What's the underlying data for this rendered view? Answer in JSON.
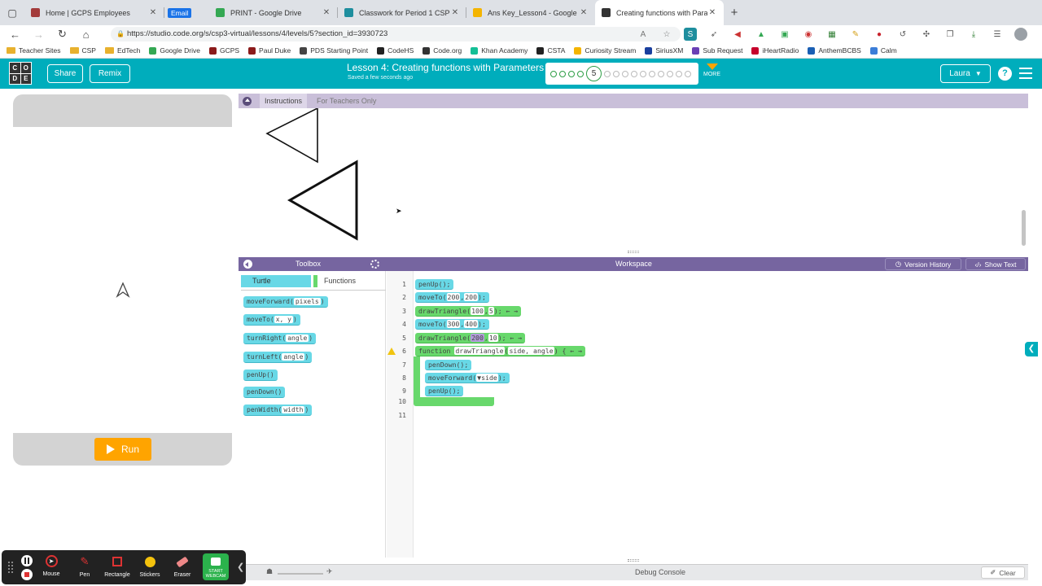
{
  "browser": {
    "tabs": [
      {
        "title": "Home | GCPS Employees",
        "color": "#a33b3b"
      },
      {
        "title": "PRINT - Google Drive",
        "color": "#34a853"
      },
      {
        "title": "Classwork for Period 1 CSP",
        "color": "#1e8e9e"
      },
      {
        "title": "Ans Key_Lesson4 - Google Sli",
        "color": "#f4b400"
      },
      {
        "title": "Creating functions with Param",
        "color": "#333333"
      }
    ],
    "email_badge": "Email",
    "url": "https://studio.code.org/s/csp3-virtual/lessons/4/levels/5?section_id=3930723",
    "bookmarks": [
      {
        "label": "Teacher Sites",
        "type": "folder"
      },
      {
        "label": "CSP",
        "type": "folder"
      },
      {
        "label": "EdTech",
        "type": "folder"
      },
      {
        "label": "Google Drive",
        "type": "site",
        "color": "#34a853"
      },
      {
        "label": "GCPS",
        "type": "site",
        "color": "#8b1a1a"
      },
      {
        "label": "Paul Duke",
        "type": "site",
        "color": "#8b1a1a"
      },
      {
        "label": "PDS Starting Point",
        "type": "site",
        "color": "#444444"
      },
      {
        "label": "CodeHS",
        "type": "site",
        "color": "#222222"
      },
      {
        "label": "Code.org",
        "type": "site",
        "color": "#333333"
      },
      {
        "label": "Khan Academy",
        "type": "site",
        "color": "#14bf96"
      },
      {
        "label": "CSTA",
        "type": "site",
        "color": "#222222"
      },
      {
        "label": "Curiosity Stream",
        "type": "site",
        "color": "#f4b400"
      },
      {
        "label": "SiriusXM",
        "type": "site",
        "color": "#1a3f9e"
      },
      {
        "label": "Sub Request",
        "type": "site",
        "color": "#6a3fb5"
      },
      {
        "label": "iHeartRadio",
        "type": "site",
        "color": "#c6002b"
      },
      {
        "label": "AnthemBCBS",
        "type": "site",
        "color": "#1a5fb4"
      },
      {
        "label": "Calm",
        "type": "site",
        "color": "#3b7dd8"
      }
    ]
  },
  "header": {
    "logo_letters": [
      "C",
      "O",
      "D",
      "E"
    ],
    "share_label": "Share",
    "remix_label": "Remix",
    "lesson_title": "Lesson 4: Creating functions with Parameters",
    "saved_text": "Saved a few seconds ago",
    "current_level": "5",
    "more_label": "MORE",
    "user_name": "Laura",
    "help_glyph": "?"
  },
  "visualization": {
    "run_label": "Run"
  },
  "instructions": {
    "tab_instructions": "Instructions",
    "tab_teachers": "For Teachers Only"
  },
  "toolbox": {
    "title": "Toolbox",
    "category_turtle": "Turtle",
    "category_functions": "Functions",
    "blocks": [
      {
        "name": "moveForward",
        "arg": "pixels"
      },
      {
        "name": "moveTo",
        "arg": "x, y"
      },
      {
        "name": "turnRight",
        "arg": "angle"
      },
      {
        "name": "turnLeft",
        "arg": "angle"
      },
      {
        "name": "penUp",
        "arg": ""
      },
      {
        "name": "penDown",
        "arg": ""
      },
      {
        "name": "penWidth",
        "arg": "width"
      }
    ]
  },
  "workspace": {
    "title": "Workspace",
    "version_history": "Version History",
    "show_text": "Show Text",
    "line_numbers": [
      "1",
      "2",
      "3",
      "4",
      "5",
      "6",
      "7",
      "8",
      "9",
      "10",
      "11"
    ],
    "code": {
      "l1": "penUp();",
      "l2_fn": "moveTo(",
      "l2_a": "200",
      "l2_b": "200",
      "l3_fn": "drawTriangle(",
      "l3_a": "100",
      "l3_b": "5",
      "l4_fn": "moveTo(",
      "l4_a": "300",
      "l4_b": "400",
      "l5_fn": "drawTriangle(",
      "l5_a": "200",
      "l5_b": "10",
      "l6_kw": "function",
      "l6_name": "drawTriangle",
      "l6_params": "side, angle",
      "l7": "penDown();",
      "l8_fn": "moveForward(",
      "l8_a": "▼side",
      "l9": "penUp();",
      "close": ";",
      "end": ");",
      "sep": ",",
      "arrows": "← →"
    }
  },
  "debug": {
    "title": "Debug Console",
    "clear_label": "Clear"
  },
  "annotation_toolbar": {
    "tools": [
      {
        "label": "Mouse",
        "icon": "mouse-icon"
      },
      {
        "label": "Pen",
        "icon": "pen-icon"
      },
      {
        "label": "Rectangle",
        "icon": "rectangle-icon"
      },
      {
        "label": "Stickers",
        "icon": "sticker-icon"
      },
      {
        "label": "Eraser",
        "icon": "eraser-icon"
      }
    ],
    "webcam_label": "START WEBCAM"
  },
  "colors": {
    "brand_teal": "#00adbc",
    "toolbox_purple": "#7665a0",
    "block_cyan": "#68d8e6",
    "block_green": "#68d86c",
    "run_orange": "#ffa400"
  }
}
